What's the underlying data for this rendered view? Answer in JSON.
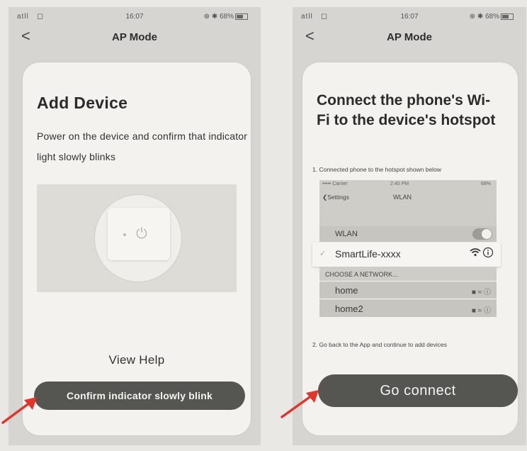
{
  "left_screen": {
    "status": {
      "signal": "atll",
      "time": "16:07",
      "battery": "68%"
    },
    "nav": {
      "back": "<",
      "title": "AP Mode"
    },
    "heading": "Add Device",
    "description": "Power on the device and confirm that indicator light slowly blinks",
    "view_help": "View Help",
    "confirm_button": "Confirm indicator slowly blink"
  },
  "right_screen": {
    "status": {
      "signal": "atll",
      "time": "16:07",
      "battery": "68%"
    },
    "nav": {
      "back": "<",
      "title": "AP Mode"
    },
    "heading": "Connect the phone's Wi-Fi to the device's hotspot",
    "step1": "1. Connected phone to the hotspot shown below",
    "wlan_screen": {
      "status_carrier": "••••• Carrier",
      "status_time": "2:40 PM",
      "status_battery": "68%",
      "back": "Settings",
      "title": "WLAN",
      "wlan_label": "WLAN",
      "selected_network": "SmartLife-xxxx",
      "choose_header": "CHOOSE A NETWORK...",
      "networks": [
        "home",
        "home2"
      ]
    },
    "step2": "2. Go back to the App and continue to add devices",
    "connect_button": "Go connect"
  },
  "icons": [
    "wifi-icon",
    "battery-icon",
    "back-chevron-icon",
    "power-icon",
    "check-icon",
    "lock-icon",
    "info-icon",
    "red-arrow-icon"
  ],
  "colors": {
    "card": "#f3f2ee",
    "button": "#555552",
    "arrow": "#e0352b"
  }
}
